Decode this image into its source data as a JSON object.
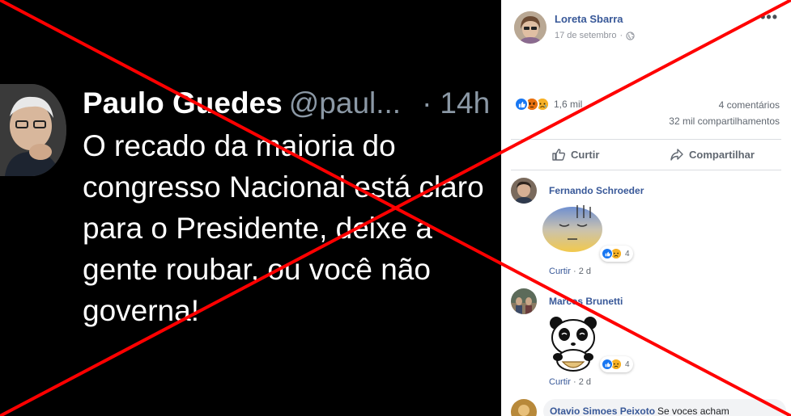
{
  "tweet": {
    "author_name": "Paulo Guedes",
    "handle": "@paul...",
    "separator": "·",
    "time": "14h",
    "lines": [
      "O recado da maioria do",
      "congresso Nacional está claro",
      "para o Presidente, deixe a",
      "gente roubar, ou você não",
      "governa!"
    ]
  },
  "post": {
    "author": "Loreta Sbarra",
    "date": "17 de setembro",
    "separator": "·",
    "privacy_icon": "globe-icon",
    "more_icon": "more-options-icon",
    "reactions": {
      "types": [
        "like",
        "angry",
        "sad"
      ],
      "count": "1,6 mil"
    },
    "comments_count": "4 comentários",
    "shares_count": "32 mil compartilhamentos",
    "actions": {
      "like_label": "Curtir",
      "share_label": "Compartilhar"
    }
  },
  "comments": [
    {
      "name": "Fernando Schroeder",
      "sticker": "embarrassed-face-sticker",
      "reaction_count": "4",
      "like_label": "Curtir",
      "separator": "·",
      "age": "2 d"
    },
    {
      "name": "Marcos Brunetti",
      "sticker": "panda-eating-sticker",
      "reaction_count": "4",
      "like_label": "Curtir",
      "separator": "·",
      "age": "2 d"
    },
    {
      "name": "Otavio Simoes Peixoto",
      "text": "Se voces acham"
    }
  ],
  "colors": {
    "overlay_x": "#ff0000",
    "link_blue": "#385898",
    "like_blue": "#1877f2",
    "tweet_bg": "#000000"
  }
}
